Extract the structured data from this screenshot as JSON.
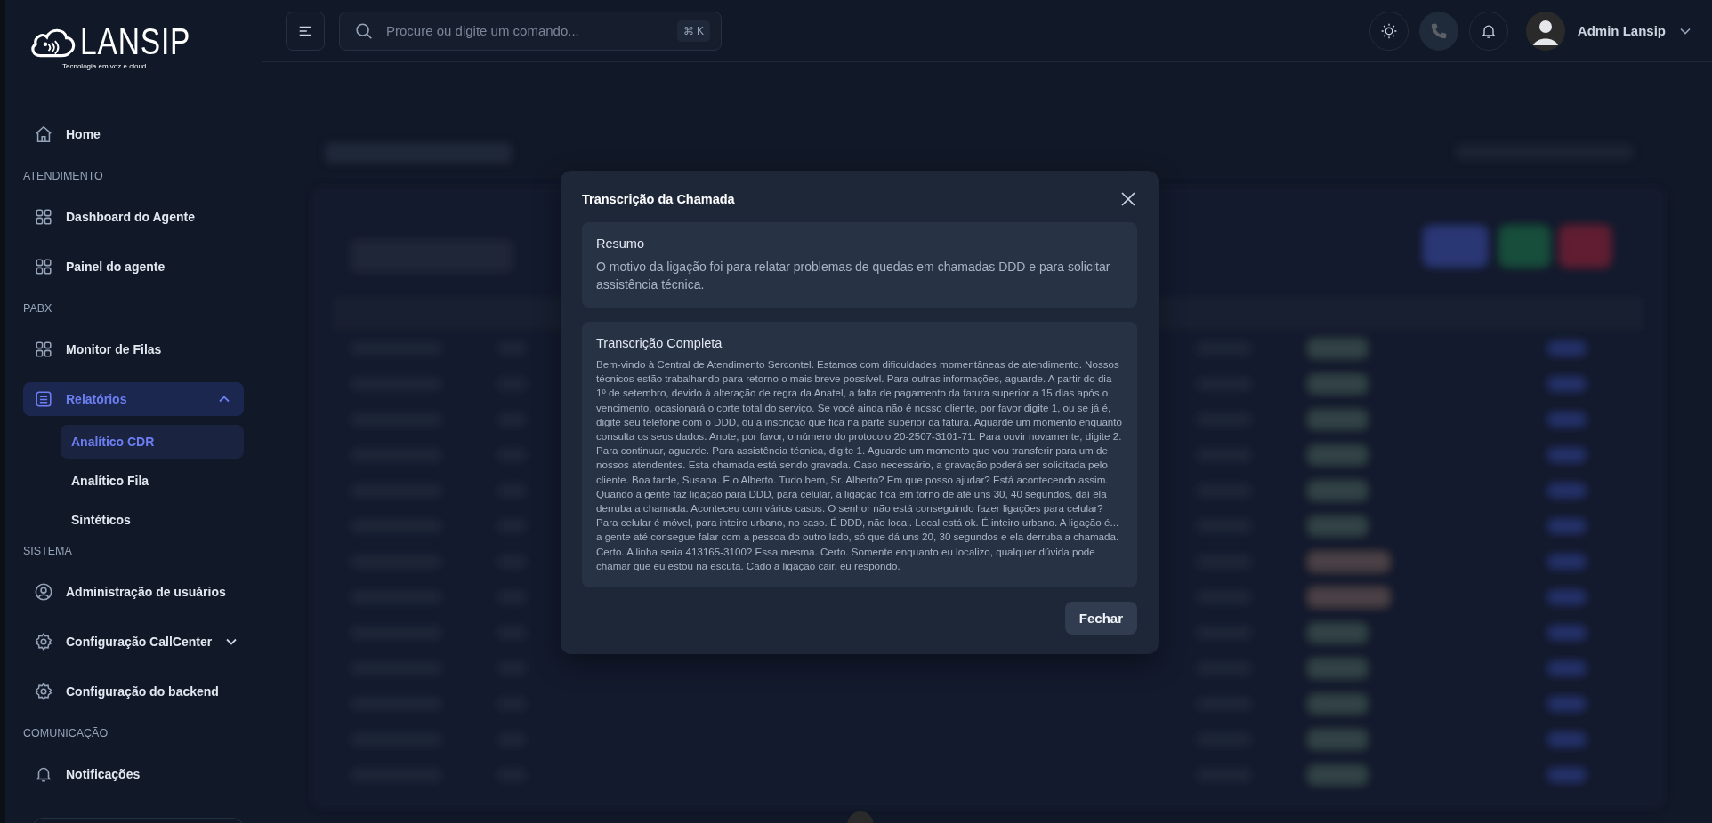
{
  "logo": {
    "wordmark": "LANSIP",
    "tagline": "Tecnologia em voz e cloud"
  },
  "sidebar": {
    "groups": [
      {
        "items": [
          {
            "label": "Home",
            "selected": false
          }
        ]
      },
      {
        "heading": "ATENDIMENTO",
        "items": [
          {
            "label": "Dashboard do Agente",
            "selected": false
          },
          {
            "label": "Painel do agente",
            "selected": false
          }
        ]
      },
      {
        "heading": "PABX",
        "items": [
          {
            "label": "Monitor de Filas",
            "selected": false
          },
          {
            "label": "Relatórios",
            "selected": true,
            "expanded": true,
            "children": [
              {
                "label": "Analítico CDR",
                "selected": true
              },
              {
                "label": "Analítico Fila",
                "selected": false
              },
              {
                "label": "Sintéticos",
                "selected": false
              }
            ]
          }
        ]
      },
      {
        "heading": "SISTEMA",
        "items": [
          {
            "label": "Administração de usuários",
            "selected": false
          },
          {
            "label": "Configuração CallCenter",
            "selected": false,
            "expanded": false
          },
          {
            "label": "Configuração do backend",
            "selected": false
          }
        ]
      },
      {
        "heading": "COMUNICAÇÃO",
        "items": [
          {
            "label": "Notificações",
            "selected": false
          }
        ]
      }
    ]
  },
  "header": {
    "search": {
      "placeholder": "Procure ou digite um comando...",
      "shortcut": "⌘ K"
    },
    "actions": [
      {
        "on": false
      },
      {
        "on": true
      },
      {
        "on": false
      }
    ],
    "user": {
      "name": "Admin Lansip"
    }
  },
  "dialog": {
    "title": "Transcrição da Chamada",
    "sections": [
      {
        "heading": "Resumo",
        "kind": "summary",
        "text": "O motivo da ligação foi para relatar problemas de quedas em chamadas DDD e para solicitar assistência técnica."
      },
      {
        "heading": "Transcrição Completa",
        "kind": "transcript",
        "text": "Bem-vindo à Central de Atendimento Sercontel. Estamos com dificuldades momentâneas de atendimento. Nossos técnicos estão trabalhando para retorno o mais breve possível. Para outras informações, aguarde. A partir do dia 1º de setembro, devido à alteração de regra da Anatel, a falta de pagamento da fatura superior a 15 dias após o vencimento, ocasionará o corte total do serviço. Se você ainda não é nosso cliente, por favor digite 1, ou se já é, digite seu telefone com o DDD, ou a inscrição que fica na parte superior da fatura. Aguarde um momento enquanto consulta os seus dados. Anote, por favor, o número do protocolo 20-2507-3101-71. Para ouvir novamente, digite 2. Para continuar, aguarde. Para assistência técnica, digite 1. Aguarde um momento que vou transferir para um de nossos atendentes. Esta chamada está sendo gravada. Caso necessário, a gravação poderá ser solicitada pelo cliente. Boa tarde, Susana. É o Alberto. Tudo bem, Sr. Alberto? Em que posso ajudar? Está acontecendo assim. Quando a gente faz ligação para DDD, para celular, a ligação fica em torno de até uns 30, 40 segundos, daí ela derruba a chamada. Aconteceu com vários casos. O senhor não está conseguindo fazer ligações para celular? Para celular é móvel, para inteiro urbano, no caso. É DDD, não local. Local está ok. É inteiro urbano. A ligação é... a gente até consegue falar com a pessoa do outro lado, só que dá uns 20, 30 segundos e ela derruba a chamada. Certo. A linha seria 413165-3100? Essa mesma. Certo. Somente enquanto eu localizo, qualquer dúvida pode chamar que eu estou na escuta. Cado a ligação cair, eu respondo."
      }
    ],
    "button": "Fechar"
  }
}
